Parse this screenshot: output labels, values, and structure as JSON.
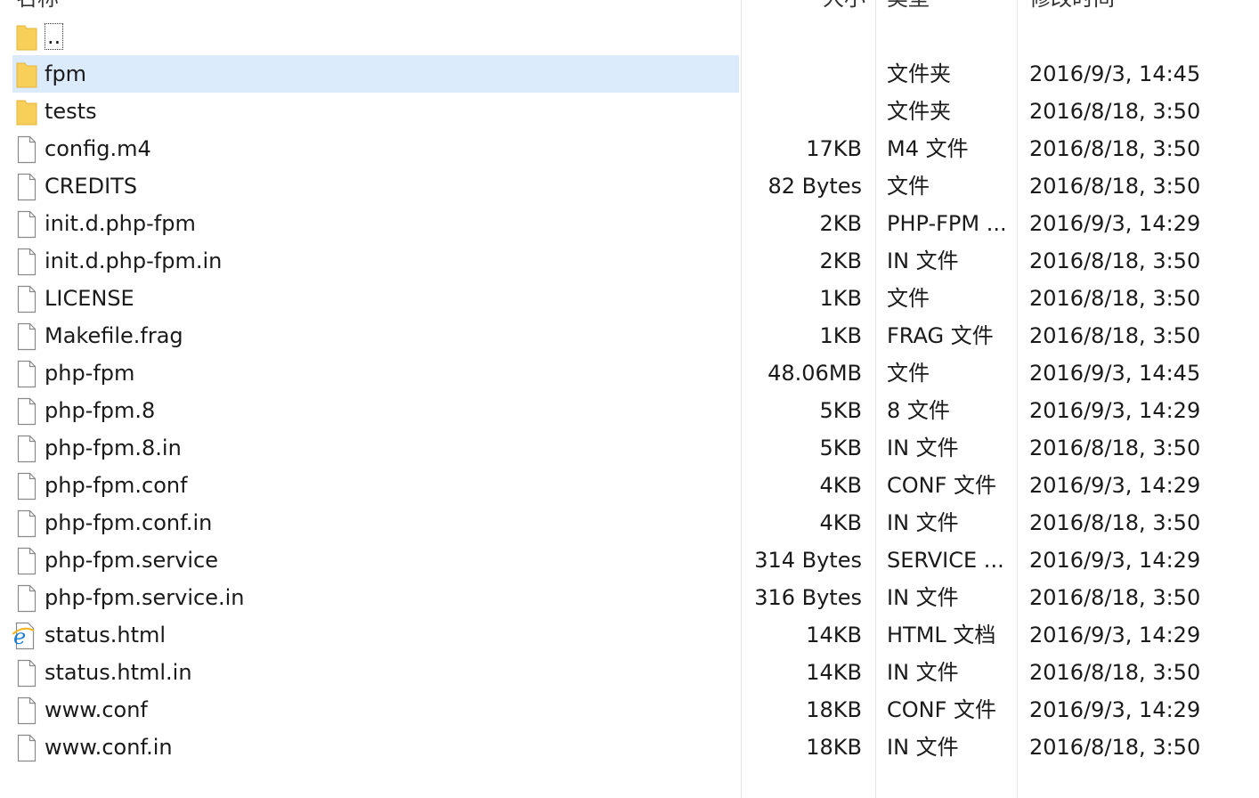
{
  "columns": {
    "name": "名称",
    "size": "大小",
    "type": "类型",
    "modified": "修改时间"
  },
  "rows": [
    {
      "name": "..",
      "size": "",
      "type": "",
      "date": "",
      "icon": "folder-icon"
    },
    {
      "name": "fpm",
      "size": "",
      "type": "文件夹",
      "date": "2016/9/3, 14:45",
      "icon": "folder-icon",
      "selected": true
    },
    {
      "name": "tests",
      "size": "",
      "type": "文件夹",
      "date": "2016/8/18, 3:50",
      "icon": "folder-icon"
    },
    {
      "name": "config.m4",
      "size": "17KB",
      "type": "M4 文件",
      "date": "2016/8/18, 3:50",
      "icon": "file-icon"
    },
    {
      "name": "CREDITS",
      "size": "82 Bytes",
      "type": "文件",
      "date": "2016/8/18, 3:50",
      "icon": "file-icon"
    },
    {
      "name": "init.d.php-fpm",
      "size": "2KB",
      "type": "PHP-FPM ...",
      "date": "2016/9/3, 14:29",
      "icon": "file-icon"
    },
    {
      "name": "init.d.php-fpm.in",
      "size": "2KB",
      "type": "IN 文件",
      "date": "2016/8/18, 3:50",
      "icon": "file-icon"
    },
    {
      "name": "LICENSE",
      "size": "1KB",
      "type": "文件",
      "date": "2016/8/18, 3:50",
      "icon": "file-icon"
    },
    {
      "name": "Makefile.frag",
      "size": "1KB",
      "type": "FRAG 文件",
      "date": "2016/8/18, 3:50",
      "icon": "file-icon"
    },
    {
      "name": "php-fpm",
      "size": "48.06MB",
      "type": "文件",
      "date": "2016/9/3, 14:45",
      "icon": "file-icon"
    },
    {
      "name": "php-fpm.8",
      "size": "5KB",
      "type": "8 文件",
      "date": "2016/9/3, 14:29",
      "icon": "file-icon"
    },
    {
      "name": "php-fpm.8.in",
      "size": "5KB",
      "type": "IN 文件",
      "date": "2016/8/18, 3:50",
      "icon": "file-icon"
    },
    {
      "name": "php-fpm.conf",
      "size": "4KB",
      "type": "CONF 文件",
      "date": "2016/9/3, 14:29",
      "icon": "file-icon"
    },
    {
      "name": "php-fpm.conf.in",
      "size": "4KB",
      "type": "IN 文件",
      "date": "2016/8/18, 3:50",
      "icon": "file-icon"
    },
    {
      "name": "php-fpm.service",
      "size": "314 Bytes",
      "type": "SERVICE ...",
      "date": "2016/9/3, 14:29",
      "icon": "file-icon"
    },
    {
      "name": "php-fpm.service.in",
      "size": "316 Bytes",
      "type": "IN 文件",
      "date": "2016/8/18, 3:50",
      "icon": "file-icon"
    },
    {
      "name": "status.html",
      "size": "14KB",
      "type": "HTML 文档",
      "date": "2016/9/3, 14:29",
      "icon": "ie-html-icon"
    },
    {
      "name": "status.html.in",
      "size": "14KB",
      "type": "IN 文件",
      "date": "2016/8/18, 3:50",
      "icon": "file-icon"
    },
    {
      "name": "www.conf",
      "size": "18KB",
      "type": "CONF 文件",
      "date": "2016/9/3, 14:29",
      "icon": "file-icon"
    },
    {
      "name": "www.conf.in",
      "size": "18KB",
      "type": "IN 文件",
      "date": "2016/8/18, 3:50",
      "icon": "file-icon"
    }
  ],
  "colors": {
    "selection": "#dcebfc",
    "folder": "#f7cf59",
    "divider": "#e6e6e6"
  }
}
